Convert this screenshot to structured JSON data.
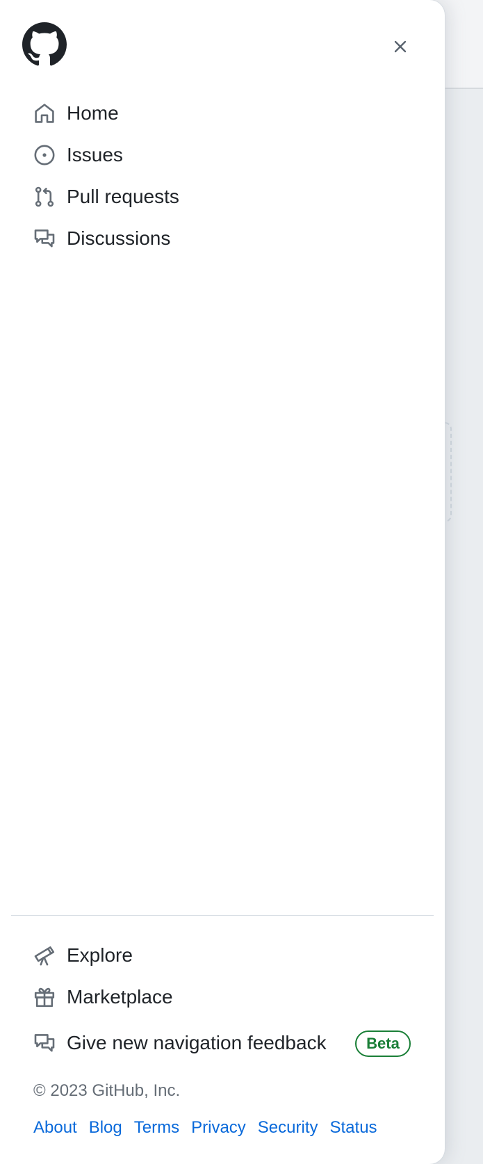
{
  "header": {
    "logo": "github-mark-icon",
    "close": "close-icon"
  },
  "nav": {
    "primary": [
      {
        "label": "Home",
        "icon": "home-icon"
      },
      {
        "label": "Issues",
        "icon": "issue-opened-icon"
      },
      {
        "label": "Pull requests",
        "icon": "git-pull-request-icon"
      },
      {
        "label": "Discussions",
        "icon": "comment-discussion-icon"
      }
    ],
    "secondary": [
      {
        "label": "Explore",
        "icon": "telescope-icon"
      },
      {
        "label": "Marketplace",
        "icon": "gift-icon"
      },
      {
        "label": "Give new navigation feedback",
        "icon": "comment-discussion-icon",
        "badge": "Beta"
      }
    ]
  },
  "footer": {
    "copyright": "© 2023 GitHub, Inc.",
    "links": [
      "About",
      "Blog",
      "Terms",
      "Privacy",
      "Security",
      "Status"
    ]
  },
  "colors": {
    "text": "#1f2328",
    "icon": "#656d76",
    "link": "#0969da",
    "badge": "#1a7f37",
    "muted": "#656d76"
  }
}
